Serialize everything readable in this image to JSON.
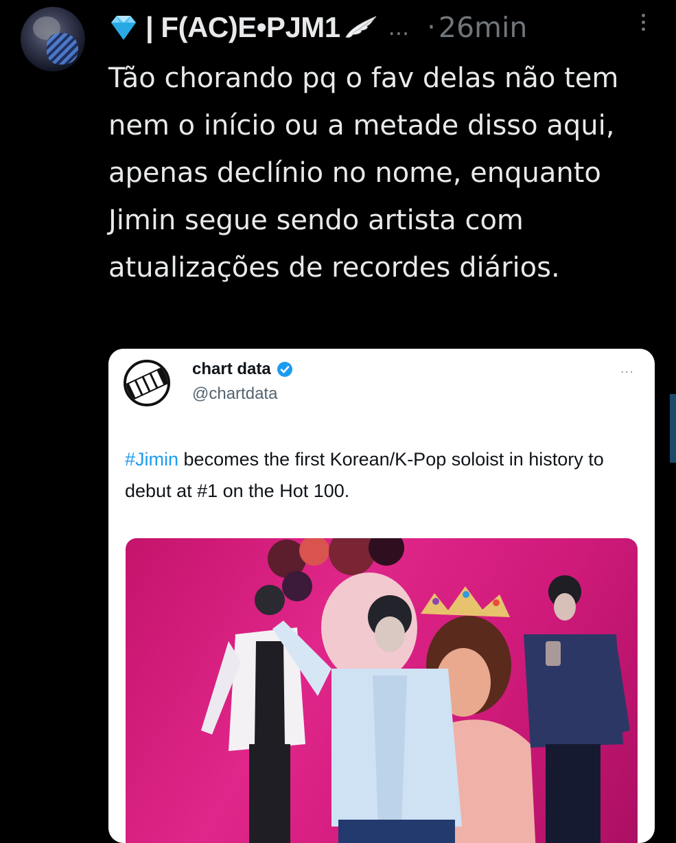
{
  "tweet": {
    "display_name": "| F(AC)E•PJM1",
    "ellipsis": "...",
    "separator": "·",
    "timestamp": "26min",
    "text": "Tão chorando pq o fav delas não tem nem o início ou a metade disso aqui, apenas declínio no nome, enquanto Jimin segue sendo artista com atualizações de recordes diários."
  },
  "quoted": {
    "name": "chart data",
    "handle": "@chartdata",
    "more": "···",
    "hashtag": "#Jimin",
    "text": " becomes the first Korean/K-Pop soloist in history to debut at #1 on the Hot 100."
  },
  "icons": {
    "badge": "diamond-icon",
    "decoration": "wing-icon",
    "verified": "verified-badge-icon",
    "more": "more-vertical-icon"
  },
  "colors": {
    "background": "#000000",
    "text": "#e7e9ea",
    "secondary": "#71767b",
    "hashtag": "#1d9bf0",
    "verified": "#1d9bf0",
    "media_pink": "#e0268a"
  }
}
